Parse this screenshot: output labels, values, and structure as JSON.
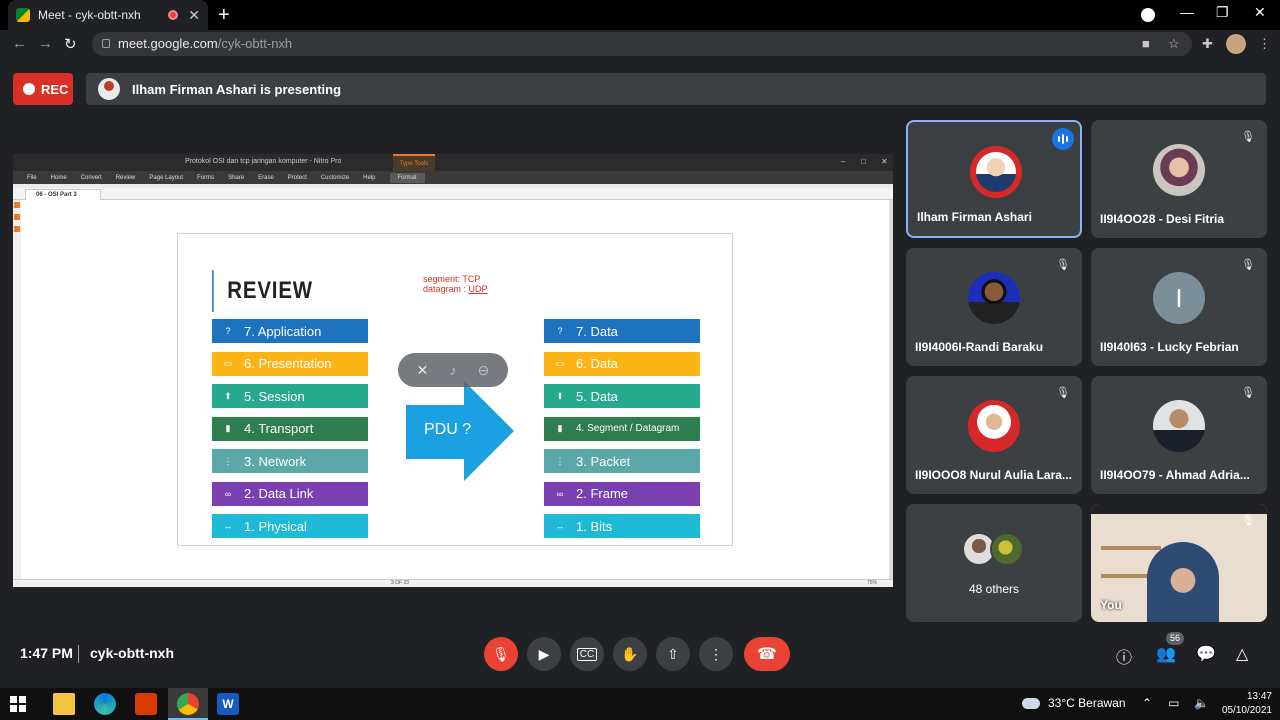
{
  "browser": {
    "tab_title": "Meet - cyk-obtt-nxh",
    "tab_close": "✕",
    "new_tab": "+",
    "url_domain": "meet.google.com",
    "url_path": "/cyk-obtt-nxh"
  },
  "meet": {
    "rec_label": "REC",
    "presenting_text": "Ilham Firman Ashari is presenting",
    "time": "1:47 PM",
    "meeting_code": "cyk-obtt-nxh",
    "participant_count": "56"
  },
  "nitro": {
    "window_title": "Protokol OSI dan tcp jaringan komputer - Nitro Pro",
    "type_tools": "Type Tools",
    "menu": [
      "File",
      "Home",
      "Convert",
      "Review",
      "Page Layout",
      "Forms",
      "Share",
      "Erase",
      "Protect",
      "Customize",
      "Help",
      "Format"
    ],
    "doc_tab": "06 - OSI Part 3",
    "page_indicator": "3 OF 33",
    "zoom": "75%"
  },
  "slide": {
    "title": "REVIEW",
    "note_line1": "segment: TCP",
    "note_line2_prefix": "datagram : ",
    "note_line2_underlined": "UDP",
    "arrow_label": "PDU ?",
    "left_layers": [
      {
        "label": "7. Application",
        "color": "#1e73be",
        "icon": "?"
      },
      {
        "label": "6. Presentation",
        "color": "#fbb416",
        "icon": "▭"
      },
      {
        "label": "5. Session",
        "color": "#27a98d",
        "icon": "⬆"
      },
      {
        "label": "4. Transport",
        "color": "#2e7d4f",
        "icon": "▮"
      },
      {
        "label": "3. Network",
        "color": "#5aa8a8",
        "icon": "⋮"
      },
      {
        "label": "2. Data Link",
        "color": "#7a3fb0",
        "icon": "∞"
      },
      {
        "label": "1. Physical",
        "color": "#1fb8d6",
        "icon": "↔"
      }
    ],
    "right_layers": [
      {
        "label": "7. Data",
        "color": "#1e73be",
        "icon": "?"
      },
      {
        "label": "6. Data",
        "color": "#fbb416",
        "icon": "▭"
      },
      {
        "label": "5. Data",
        "color": "#27a98d",
        "icon": "⬆"
      },
      {
        "label": "4. Segment / Datagram",
        "color": "#2e7d4f",
        "icon": "▮"
      },
      {
        "label": "3. Packet",
        "color": "#5aa8a8",
        "icon": "⋮"
      },
      {
        "label": "2. Frame",
        "color": "#7a3fb0",
        "icon": "∞"
      },
      {
        "label": "1. Bits",
        "color": "#1fb8d6",
        "icon": "↔"
      }
    ]
  },
  "participants": [
    {
      "name": "Ilham Firman Ashari",
      "avatar": "red"
    },
    {
      "name": "II9I4OO28 - Desi Fitria",
      "avatar": "pink"
    },
    {
      "name": "II9I4006I-Randi Baraku",
      "avatar": "blue"
    },
    {
      "name": "II9I40I63 - Lucky Febrian",
      "avatar": "letter",
      "letter": "I"
    },
    {
      "name": "II9IOOO8 Nurul Aulia Lara...",
      "avatar": "hijab"
    },
    {
      "name": "II9I4OO79 - Ahmad Adria...",
      "avatar": "suit"
    }
  ],
  "others_label": "48 others",
  "self_label": "You",
  "taskbar": {
    "weather": "33°C Berawan",
    "clock_time": "13:47",
    "clock_date": "05/10/2021"
  },
  "icons": {
    "speaking": "audio-level-icon",
    "mic_off": "mic-off-icon",
    "camera": "camera-icon",
    "captions": "captions-icon",
    "hand": "raise-hand-icon",
    "present": "present-icon",
    "more": "more-vert-icon",
    "hangup": "hang-up-icon",
    "info": "info-icon",
    "people": "people-icon",
    "chat": "chat-icon",
    "activities": "activities-icon"
  },
  "colors": {
    "meet_bg": "#202124",
    "tile_bg": "#3c4043",
    "rec_red": "#d93025",
    "accent_blue": "#1a73e8",
    "hangup_red": "#ea4335"
  }
}
